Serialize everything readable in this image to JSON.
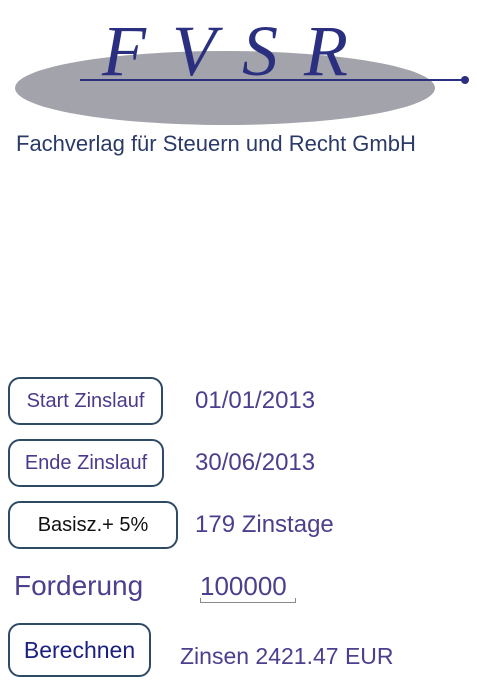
{
  "logo": {
    "text": "FVSR",
    "ellipse_color": "#a3a3ab",
    "text_color": "#2b2f80"
  },
  "header": {
    "company_name": "Fachverlag für Steuern und Recht GmbH"
  },
  "form": {
    "start_button_label": "Start Zinslauf",
    "start_date": "01/01/2013",
    "end_button_label": "Ende Zinslauf",
    "end_date": "30/06/2013",
    "rate_button_label": "Basisz.+ 5%",
    "interest_days": "179 Zinstage",
    "claim_label": "Forderung",
    "claim_value": "100000",
    "calculate_button_label": "Berechnen",
    "result": "Zinsen 2421.47 EUR"
  },
  "colors": {
    "button_border": "#2f4a64",
    "text_purple": "#4b3f8e",
    "company_text": "#2b3a66"
  }
}
